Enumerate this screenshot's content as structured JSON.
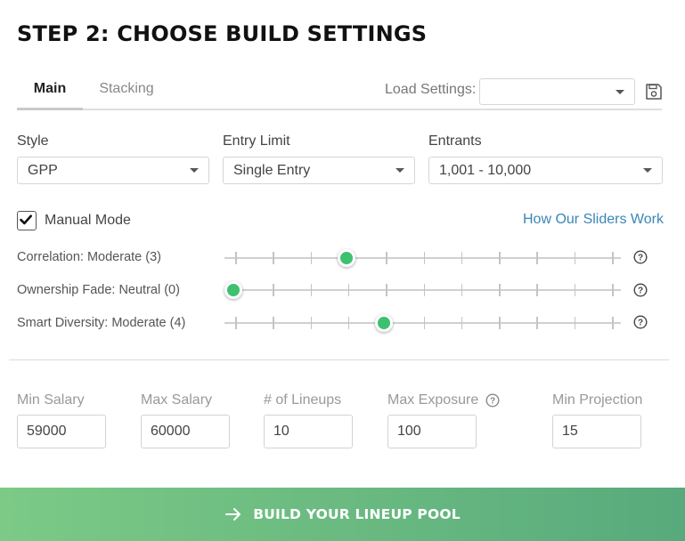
{
  "header": {
    "title": "STEP 2: CHOOSE BUILD SETTINGS"
  },
  "tabs": [
    {
      "label": "Main",
      "active": true
    },
    {
      "label": "Stacking",
      "active": false
    }
  ],
  "load_settings": {
    "label": "Load Settings:",
    "value": "",
    "save_icon": "save-icon"
  },
  "selects": {
    "style": {
      "label": "Style",
      "value": "GPP"
    },
    "entry_limit": {
      "label": "Entry Limit",
      "value": "Single Entry"
    },
    "entrants": {
      "label": "Entrants",
      "value": "1,001 - 10,000"
    }
  },
  "manual_mode": {
    "label": "Manual Mode",
    "checked": true
  },
  "sliders_link": "How Our Sliders Work",
  "sliders": [
    {
      "label": "Correlation: Moderate (3)",
      "level": 3,
      "max": 10
    },
    {
      "label": "Ownership Fade: Neutral (0)",
      "level": 0,
      "max": 10
    },
    {
      "label": "Smart Diversity: Moderate (4)",
      "level": 4,
      "max": 10
    }
  ],
  "numbers": {
    "min_salary": {
      "label": "Min Salary",
      "value": "59000"
    },
    "max_salary": {
      "label": "Max Salary",
      "value": "60000"
    },
    "lineups": {
      "label": "# of Lineups",
      "value": "10"
    },
    "max_exposure": {
      "label": "Max Exposure",
      "value": "100"
    },
    "min_projection": {
      "label": "Min Projection",
      "value": "15"
    }
  },
  "build_button": {
    "label": "BUILD YOUR LINEUP POOL"
  },
  "colors": {
    "accent_green": "#3dc16e",
    "link_blue": "#3a86b8",
    "button_start": "#7cca86",
    "button_end": "#58aa7c"
  }
}
